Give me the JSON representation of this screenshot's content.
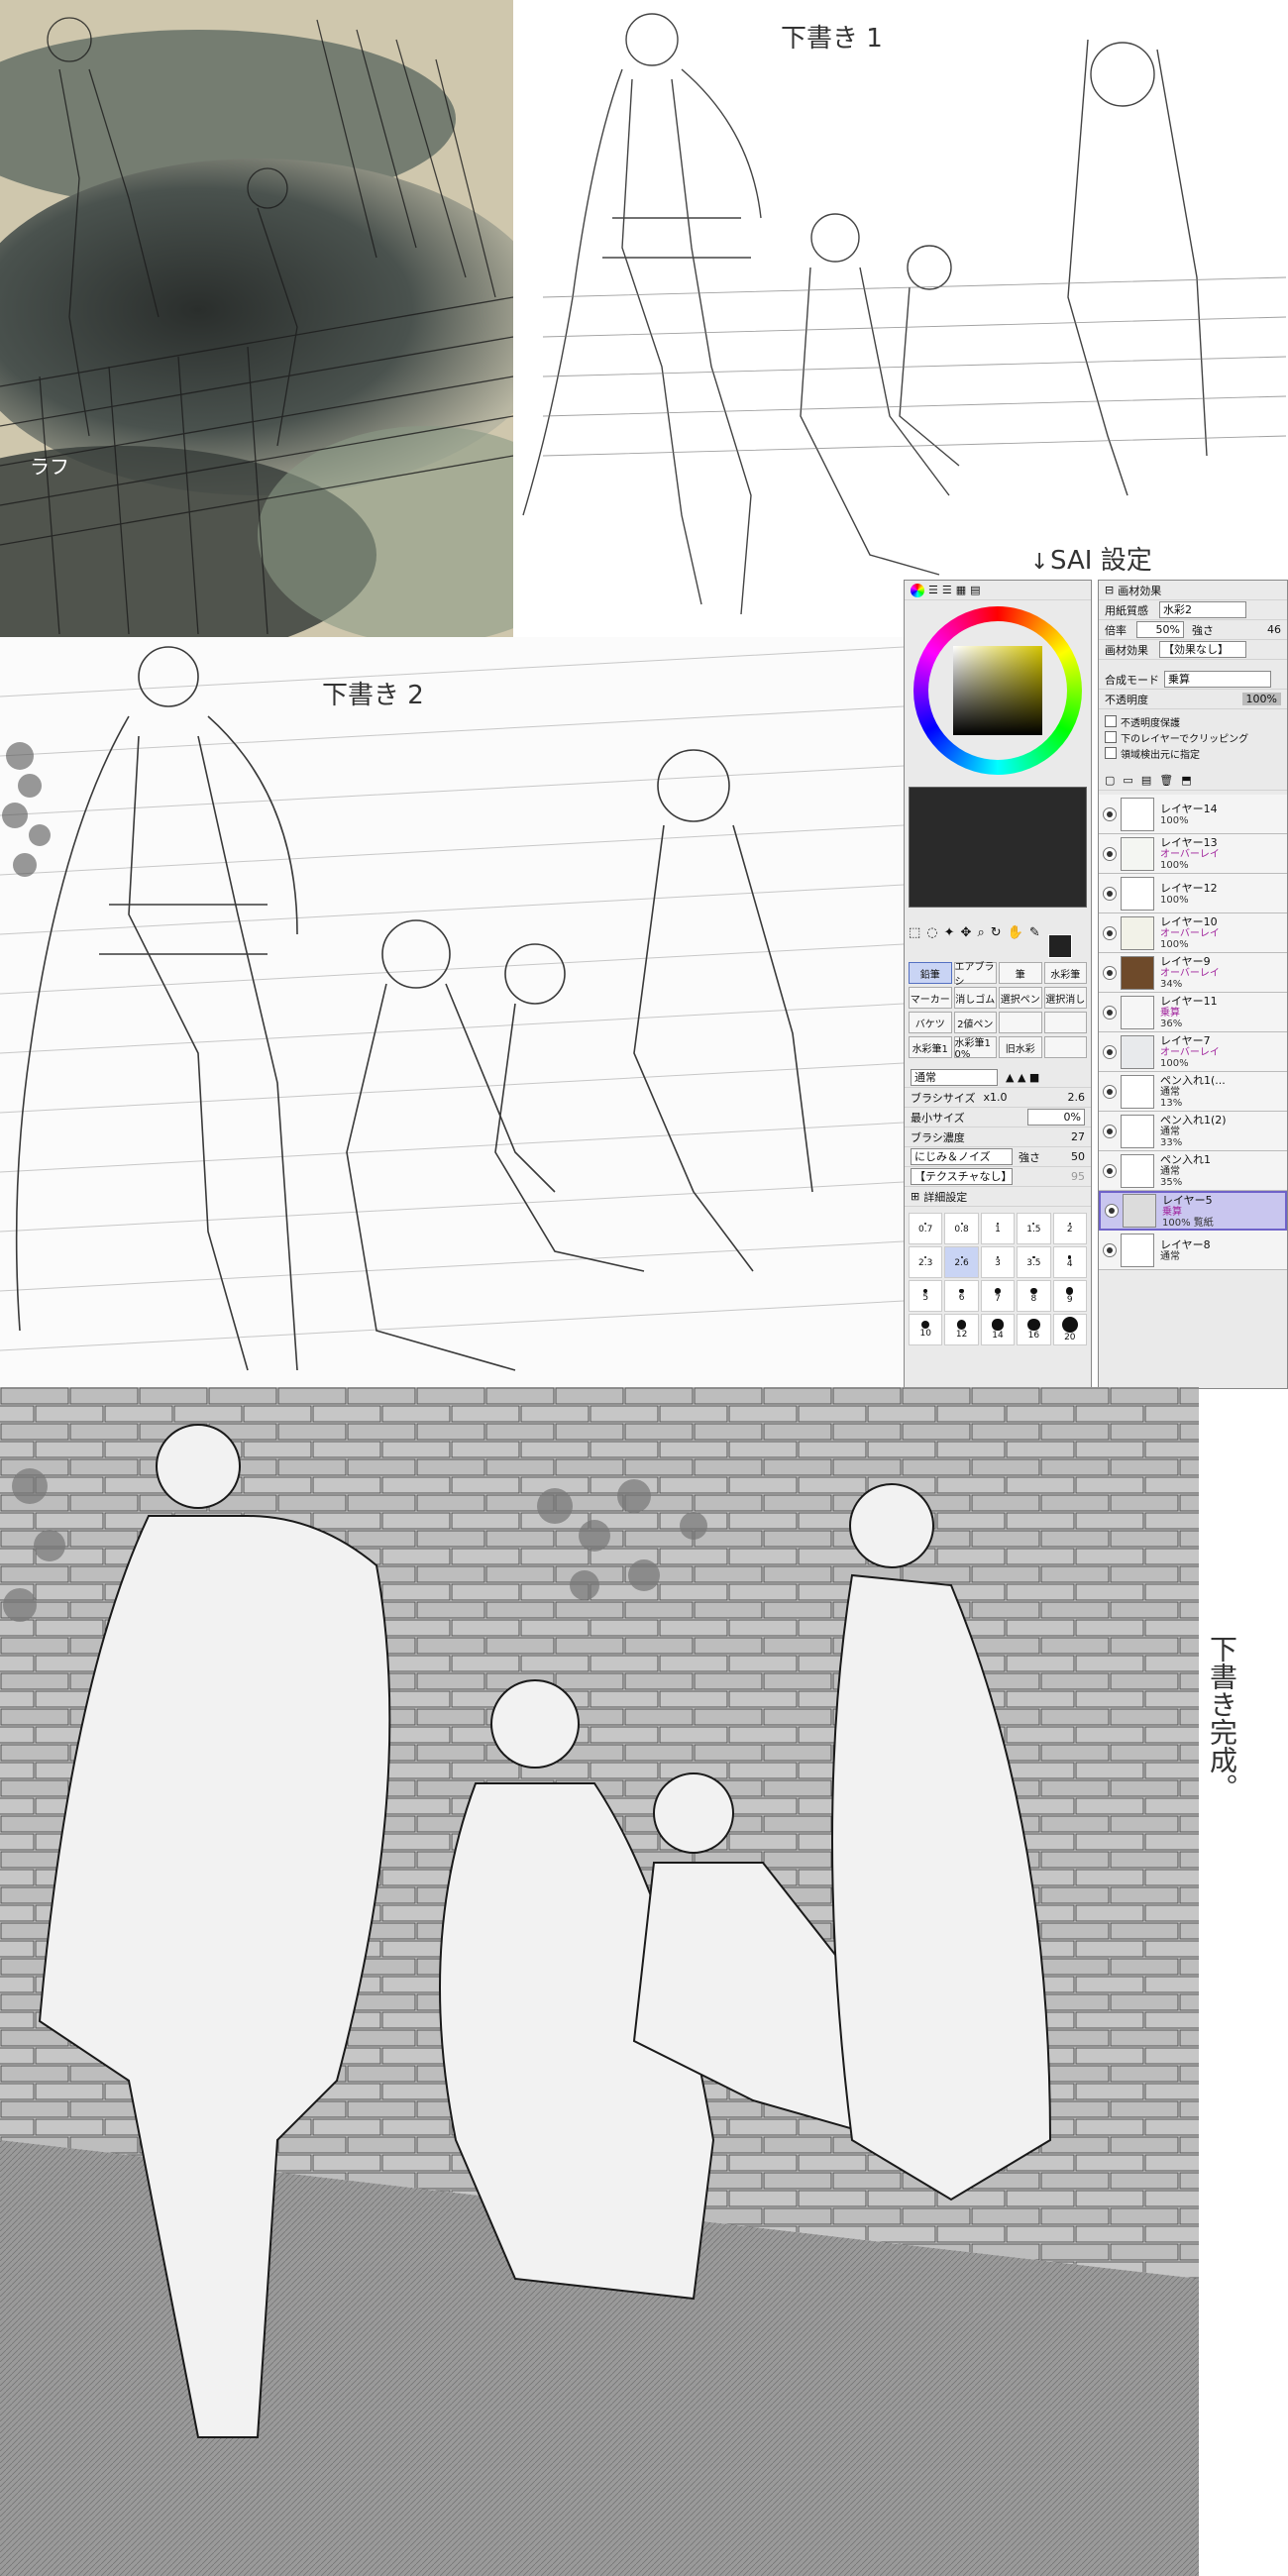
{
  "labels": {
    "rough": "ラフ",
    "draft1": "下書き 1",
    "draft2": "下書き 2",
    "sai_settings": "SAI 設定",
    "draft_done": "下書き完成。"
  },
  "brush_panel": {
    "tools": [
      [
        "鉛筆",
        "エアブラシ",
        "筆",
        "水彩筆"
      ],
      [
        "マーカー",
        "消しゴム",
        "選択ペン",
        "選択消し"
      ],
      [
        "バケツ",
        "2値ペン",
        "",
        ""
      ],
      [
        "水彩筆1",
        "水彩筆1 0%",
        "旧水彩",
        ""
      ]
    ],
    "mode": "通常",
    "brush_size_label": "ブラシサイズ",
    "brush_size_mult": "x1.0",
    "brush_size_value": "2.6",
    "min_size_label": "最小サイズ",
    "min_size_value": "0%",
    "density_label": "ブラシ濃度",
    "density_value": "27",
    "blur_label": "にじみ＆ノイズ",
    "blur_strength_label": "強さ",
    "blur_value": "50",
    "texture_label": "【テクスチャなし】",
    "texture_value": "95",
    "detail_label": "詳細設定",
    "sizes": [
      "0.7",
      "0.8",
      "1",
      "1.5",
      "2",
      "2.3",
      "2.6",
      "3",
      "3.5",
      "4",
      "5",
      "6",
      "7",
      "8",
      "9",
      "10",
      "12",
      "14",
      "16",
      "20"
    ]
  },
  "layer_panel": {
    "paper_effect_title": "画材効果",
    "paper_texture_label": "用紙質感",
    "paper_texture_value": "水彩2",
    "scale_label": "倍率",
    "scale_value": "50%",
    "strength_label": "強さ",
    "strength_value": "46",
    "material_label": "画材効果",
    "material_value": "【効果なし】",
    "blend_mode_label": "合成モード",
    "blend_mode_value": "乗算",
    "opacity_label": "不透明度",
    "opacity_value": "100%",
    "options": [
      "不透明度保護",
      "下のレイヤーでクリッピング",
      "領域検出元に指定"
    ],
    "layers": [
      {
        "name": "レイヤー14",
        "mode": "",
        "opacity": "100%",
        "thumb": "#ffffff",
        "mode_color": "#222"
      },
      {
        "name": "レイヤー13",
        "mode": "オーバーレイ",
        "opacity": "100%",
        "thumb": "#f4f6f2",
        "mode_color": "#a0229c"
      },
      {
        "name": "レイヤー12",
        "mode": "",
        "opacity": "100%",
        "thumb": "#ffffff",
        "mode_color": "#222"
      },
      {
        "name": "レイヤー10",
        "mode": "オーバーレイ",
        "opacity": "100%",
        "thumb": "#f2f2e8",
        "mode_color": "#a0229c"
      },
      {
        "name": "レイヤー9",
        "mode": "オーバーレイ",
        "opacity": "34%",
        "thumb": "#6e4a2a",
        "mode_color": "#a0229c"
      },
      {
        "name": "レイヤー11",
        "mode": "乗算",
        "opacity": "36%",
        "thumb": "#f6f6f6",
        "mode_color": "#a0229c"
      },
      {
        "name": "レイヤー7",
        "mode": "オーバーレイ",
        "opacity": "100%",
        "thumb": "#e8eaec",
        "mode_color": "#a0229c"
      },
      {
        "name": "ペン入れ1(...",
        "mode": "通常",
        "opacity": "13%",
        "thumb": "#ffffff",
        "mode_color": "#222"
      },
      {
        "name": "ペン入れ1(2)",
        "mode": "通常",
        "opacity": "33%",
        "thumb": "#ffffff",
        "mode_color": "#222"
      },
      {
        "name": "ペン入れ1",
        "mode": "通常",
        "opacity": "35%",
        "thumb": "#ffffff",
        "mode_color": "#222"
      },
      {
        "name": "レイヤー5",
        "mode": "乗算",
        "opacity": "100% 覧紙",
        "thumb": "#dcdcdc",
        "mode_color": "#a0229c",
        "selected": true
      },
      {
        "name": "レイヤー8",
        "mode": "通常",
        "opacity": "",
        "thumb": "#ffffff",
        "mode_color": "#222"
      }
    ]
  }
}
